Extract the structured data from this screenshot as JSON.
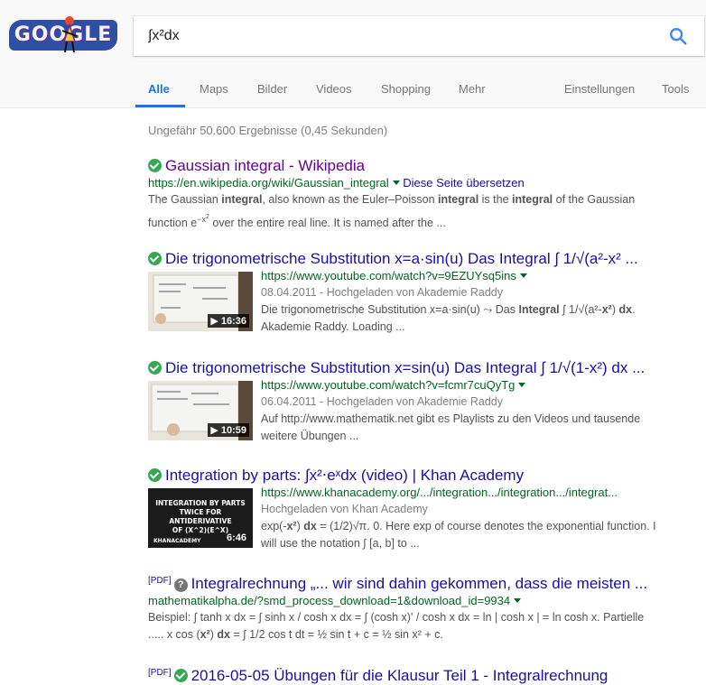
{
  "logo": {
    "text": "GOOGLE",
    "colors": {
      "bg": "#2f4fa3",
      "accent": "#6b2a8d"
    }
  },
  "search": {
    "value": "∫x²dx",
    "icon": "magnifier-icon"
  },
  "tabs": [
    {
      "label": "Alle",
      "active": true
    },
    {
      "label": "Maps"
    },
    {
      "label": "Bilder"
    },
    {
      "label": "Videos"
    },
    {
      "label": "Shopping"
    },
    {
      "label": "Mehr"
    }
  ],
  "tools": {
    "settings": "Einstellungen",
    "tools": "Tools"
  },
  "stats": "Ungefähr 50.600 Ergebnisse (0,45 Sekunden)",
  "results": [
    {
      "title": "Gaussian integral - Wikipedia",
      "url": "https://en.wikipedia.org/wiki/Gaussian_integral",
      "translate": "Diese Seite übersetzen",
      "snippet1_a": "The Gaussian ",
      "snippet1_b": "integral",
      "snippet1_c": ", also known as the Euler–Poisson ",
      "snippet1_d": "integral",
      "snippet1_e": " is the ",
      "snippet1_f": "integral",
      "snippet1_g": " of the Gaussian",
      "snippet2_a": "function e",
      "snippet2_sup": "−x",
      "snippet2_sup2": "2",
      "snippet2_b": " over the entire real line. It is named after the ..."
    },
    {
      "title": "Die trigonometrische Substitution x=a·sin(u) Das Integral ∫ 1/√(a²-x² ...",
      "url": "https://www.youtube.com/watch?v=9EZUYsq5ins",
      "date": "08.04.2011 - Hochgeladen von Akademie Raddy",
      "snippet1_a": "Die trigonometrische Substitution x=a·sin(u) ⤳ Das ",
      "snippet1_b": "Integral",
      "snippet1_c": " ∫ 1/√(a²-",
      "snippet1_d": "x²",
      "snippet1_e": ") ",
      "snippet1_f": "dx",
      "snippet1_g": ".",
      "snippet2": "Akademie Raddy. Loading ...",
      "duration": "▶ 16:36"
    },
    {
      "title": "Die trigonometrische Substitution x=sin(u) Das Integral ∫ 1/√(1-x²) dx ...",
      "url": "https://www.youtube.com/watch?v=fcmr7cuQyTg",
      "date": "06.04.2011 - Hochgeladen von Akademie Raddy",
      "snippet1": "Auf http://www.mathematik.net gibt es Playlists zu den Videos und tausende",
      "snippet2": "weitere Übungen ...",
      "duration": "▶ 10:59"
    },
    {
      "title": "Integration by parts: ∫x²⋅eˣdx (video) | Khan Academy",
      "url": "https://www.khanacademy.org/.../integration.../integration.../integrat...",
      "date": "Hochgeladen von Khan Academy",
      "snippet1_a": "exp(-",
      "snippet1_b": "x²",
      "snippet1_c": ") ",
      "snippet1_d": "dx",
      "snippet1_e": " = (1/2)√π. 0. Here exp of course denotes the exponential function. I",
      "snippet2": "will use the notation ∫ [a, b] to ...",
      "duration": "6:46",
      "thumb_text": [
        "INTEGRATION BY PARTS",
        "TWICE FOR ANTIDERIVATIVE",
        "OF (X^2)(E^X)"
      ],
      "thumb_brand": "KHANACADEMY"
    },
    {
      "pdf": "[PDF]",
      "title": "Integralrechnung „... wir sind dahin gekommen, dass die meisten ...",
      "url": "mathematikalpha.de/?smd_process_download=1&download_id=9934",
      "snippet1": "Beispiel: ∫ tanh x dx = ∫ sinh x / cosh x dx = ∫ (cosh x)' / cosh x dx = ln | cosh x | = ln cosh x. Partielle",
      "snippet2_a": "..... x cos (",
      "snippet2_b": "x²",
      "snippet2_c": ") ",
      "snippet2_d": "dx",
      "snippet2_e": " = ∫ 1/2 cos t dt = ½ sin t + c = ½ sin x² + c."
    },
    {
      "pdf": "[PDF]",
      "title": "2016-05-05 Übungen für die Klausur Teil 1 - Integralrechnung"
    }
  ]
}
